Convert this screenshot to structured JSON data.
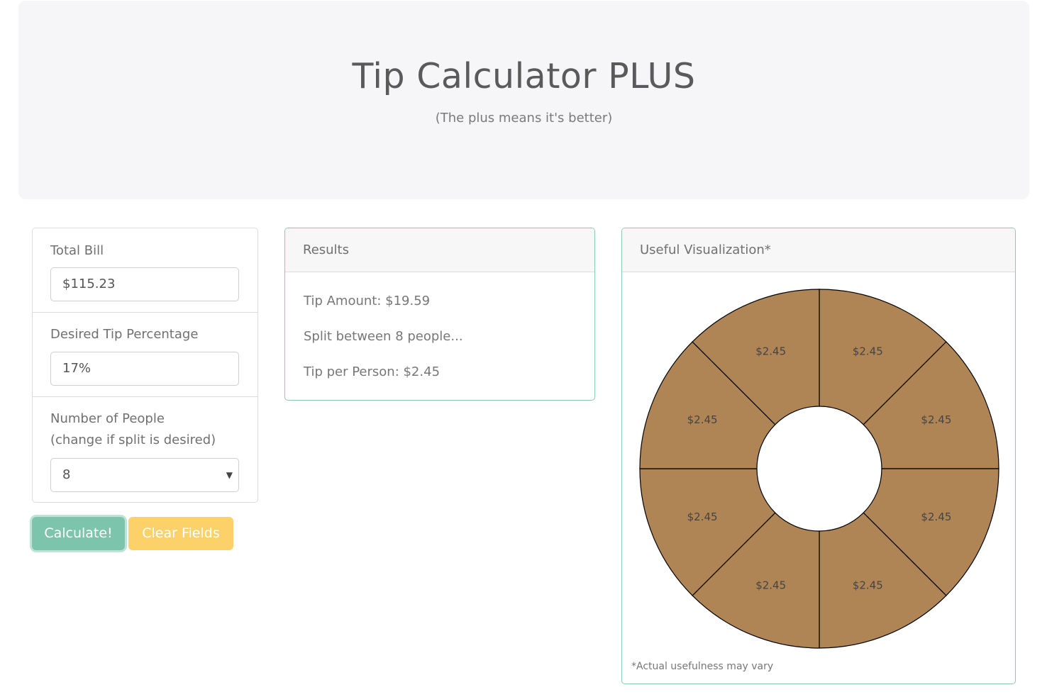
{
  "header": {
    "title": "Tip Calculator PLUS",
    "subtitle": "(The plus means it's better)"
  },
  "inputs": {
    "total_bill": {
      "label": "Total Bill",
      "value": "$115.23"
    },
    "tip_percentage": {
      "label": "Desired Tip Percentage",
      "value": "17%"
    },
    "people": {
      "label_line1": "Number of People",
      "label_line2": "(change if split is desired)",
      "selected": "8"
    }
  },
  "buttons": {
    "calculate": "Calculate!",
    "clear": "Clear Fields"
  },
  "results": {
    "title": "Results",
    "tip_amount": "Tip Amount: $19.59",
    "split": "Split between 8 people...",
    "per_person": "Tip per Person: $2.45"
  },
  "visualization": {
    "title": "Useful Visualization*",
    "footnote": "*Actual usefulness may vary",
    "slice_color": "#b08555",
    "slice_labels": [
      "$2.45",
      "$2.45",
      "$2.45",
      "$2.45",
      "$2.45",
      "$2.45",
      "$2.45",
      "$2.45"
    ]
  },
  "colors": {
    "calculate_button": "#7dc4ad",
    "clear_button": "#fcd16a",
    "card_border": "#8cc9b6"
  }
}
